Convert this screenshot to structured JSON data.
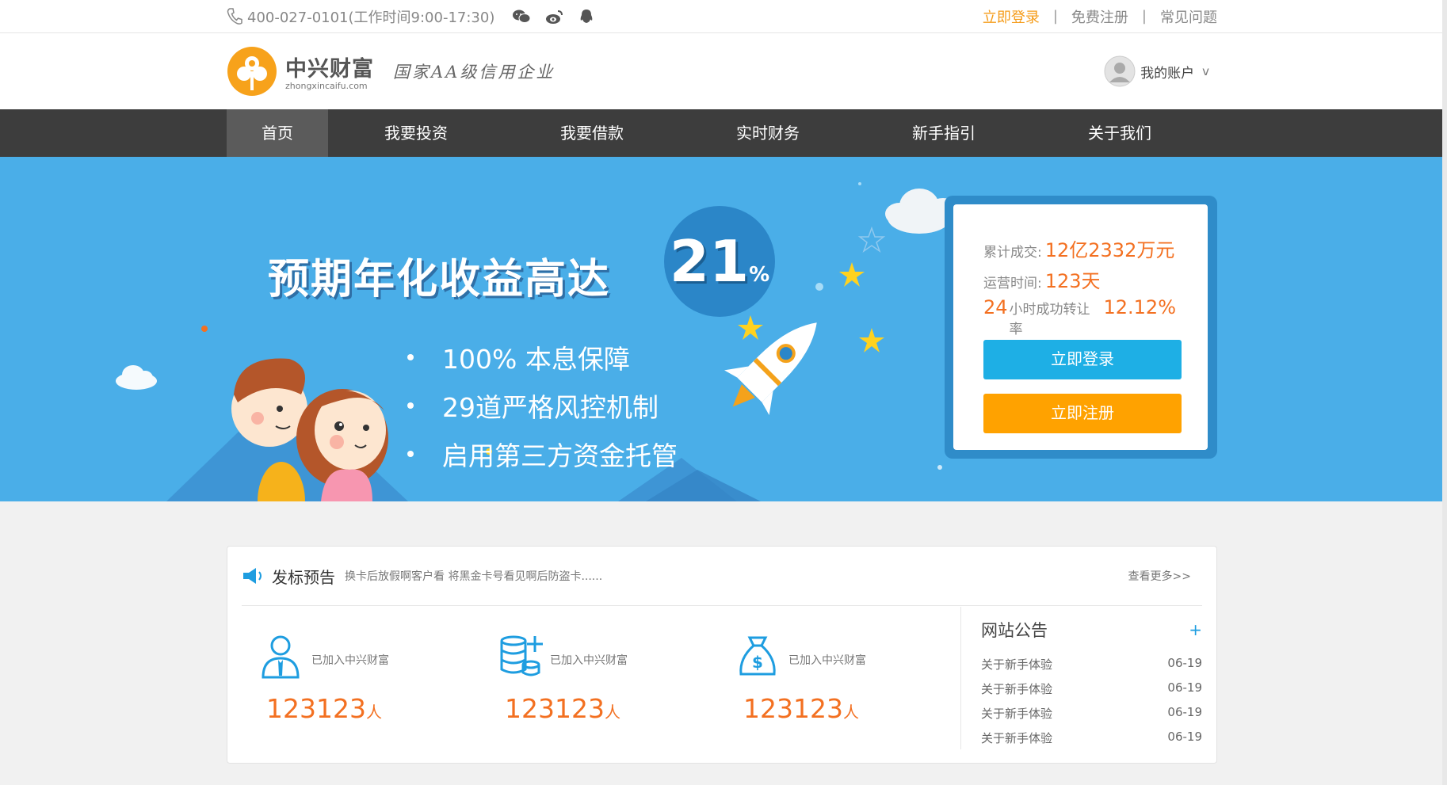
{
  "topbar": {
    "phone": "400-027-0101(工作时间9:00-17:30)",
    "links": {
      "login": "立即登录",
      "register": "免费注册",
      "faq": "常见问题"
    },
    "sep": "|"
  },
  "header": {
    "logo_cn": "中兴财富",
    "logo_en": "zhongxincaifu.com",
    "slogan": "国家AA级信用企业",
    "account": "我的账户",
    "account_chev": "v"
  },
  "nav": [
    "首页",
    "我要投资",
    "我要借款",
    "实时财务",
    "新手指引",
    "关于我们"
  ],
  "banner": {
    "headline": "预期年化收益高达",
    "rate": "21",
    "rate_unit": "%",
    "bullets": [
      "100% 本息保障",
      "29道严格风控机制",
      "启用第三方资金托管"
    ],
    "stats": {
      "total_label": "累计成交:",
      "total_value": "12亿2332万元",
      "days_label": "运营时间:",
      "days_value": "123天",
      "rate_prefix": "24",
      "rate_label": "小时成功转让率",
      "rate_value": "12.12%"
    },
    "login_btn": "立即登录",
    "register_btn": "立即注册"
  },
  "box": {
    "title": "发标预告",
    "notice": "换卡后放假啊客户看 将黑金卡号看见啊后防盗卡......",
    "more": "查看更多>>",
    "stats": [
      {
        "icon": "user-icon",
        "label": "已加入中兴财富",
        "count": "123123",
        "unit": "人"
      },
      {
        "icon": "coins-icon",
        "label": "已加入中兴财富",
        "count": "123123",
        "unit": "人"
      },
      {
        "icon": "money-bag-icon",
        "label": "已加入中兴财富",
        "count": "123123",
        "unit": "人"
      }
    ],
    "news_title": "网站公告",
    "news_plus": "+",
    "news": [
      {
        "title": "关于新手体验",
        "date": "06-19"
      },
      {
        "title": "关于新手体验",
        "date": "06-19"
      },
      {
        "title": "关于新手体验",
        "date": "06-19"
      },
      {
        "title": "关于新手体验",
        "date": "06-19"
      }
    ]
  },
  "colors": {
    "accent_orange": "#f37021",
    "nav_bg": "#3d3d3d",
    "banner_bg": "#4aaee8",
    "login_blue": "#1eafe5",
    "register_orange": "#ffa200"
  }
}
